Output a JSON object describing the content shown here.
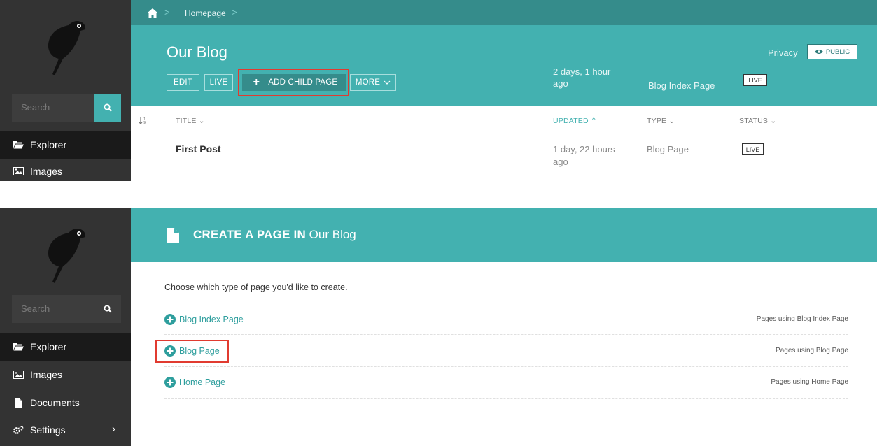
{
  "colors": {
    "teal": "#43b1b0",
    "teal_dark": "#358c8b",
    "sidebar_bg": "#333333",
    "highlight_red": "#e13b30"
  },
  "panel1": {
    "sidebar": {
      "search_placeholder": "Search",
      "items": [
        {
          "label": "Explorer",
          "icon": "folder-open-icon",
          "active": true
        },
        {
          "label": "Images",
          "icon": "image-icon",
          "active": false
        }
      ]
    },
    "breadcrumb": {
      "home_icon": "home-icon",
      "items": [
        "Homepage"
      ]
    },
    "header": {
      "title": "Our Blog",
      "buttons": {
        "edit": "EDIT",
        "live": "LIVE",
        "add_child": "ADD CHILD PAGE",
        "more": "MORE"
      },
      "updated_line1": "2 days, 1 hour",
      "updated_line2": "ago",
      "type": "Blog Index Page",
      "status": "LIVE",
      "privacy_label": "Privacy",
      "privacy_value": "PUBLIC"
    },
    "table": {
      "columns": {
        "title": "TITLE",
        "updated": "UPDATED",
        "type": "TYPE",
        "status": "STATUS"
      },
      "rows": [
        {
          "title": "First Post",
          "updated_line1": "1 day, 22 hours",
          "updated_line2": "ago",
          "type": "Blog Page",
          "status": "LIVE"
        }
      ]
    }
  },
  "panel2": {
    "sidebar": {
      "search_placeholder": "Search",
      "items": [
        {
          "label": "Explorer",
          "icon": "folder-open-icon",
          "active": true
        },
        {
          "label": "Images",
          "icon": "image-icon",
          "active": false
        },
        {
          "label": "Documents",
          "icon": "document-icon",
          "active": false
        },
        {
          "label": "Settings",
          "icon": "cogs-icon",
          "active": false
        }
      ]
    },
    "header": {
      "title_bold": "CREATE A PAGE IN",
      "title_rest": "Our Blog"
    },
    "intro": "Choose which type of page you'd like to create.",
    "page_types": [
      {
        "label": "Blog Index Page",
        "right": "Pages using Blog Index Page"
      },
      {
        "label": "Blog Page",
        "right": "Pages using Blog Page"
      },
      {
        "label": "Home Page",
        "right": "Pages using Home Page"
      }
    ]
  }
}
